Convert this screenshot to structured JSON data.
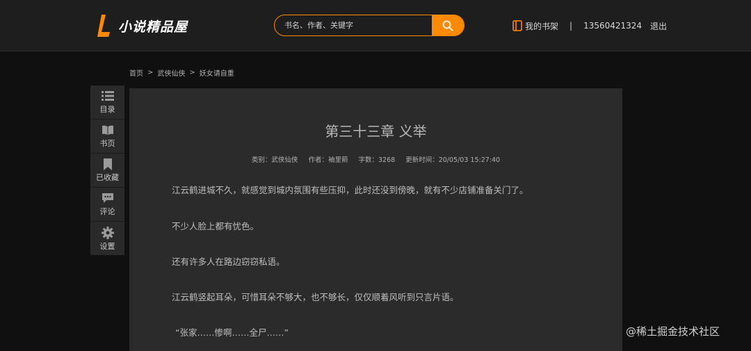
{
  "header": {
    "logo_text": "小说精品屋",
    "search_placeholder": "书名、作者、关键字",
    "shelf_label": "我的书架",
    "separator": "|",
    "phone": "13560421324",
    "logout_label": "退出",
    "accent_color": "#ff8a00"
  },
  "breadcrumb": {
    "items": [
      "首页",
      "武侠仙侠",
      "妖女请自重"
    ],
    "arrow": ">"
  },
  "sidebar": {
    "items": [
      {
        "label": "目录",
        "icon": "list-icon"
      },
      {
        "label": "书页",
        "icon": "book-icon"
      },
      {
        "label": "已收藏",
        "icon": "bookmark-icon"
      },
      {
        "label": "评论",
        "icon": "comment-icon"
      },
      {
        "label": "设置",
        "icon": "gear-icon"
      }
    ]
  },
  "chapter": {
    "title": "第三十三章 义举",
    "meta": {
      "category": "类别：武侠仙侠",
      "author": "作者：袖里箭",
      "word_count": "字数：3268",
      "updated": "更新时间：20/05/03 15:27:40"
    },
    "paragraphs": [
      "江云鹤进城不久，就感觉到城内氛围有些压抑，此时还没到傍晚，就有不少店铺准备关门了。",
      "不少人脸上都有忧色。",
      "还有许多人在路边窃窃私语。",
      "江云鹤竖起耳朵，可惜耳朵不够大，也不够长，仅仅顺着风听到只言片语。",
      "“张家……惨啊……全尸……”"
    ]
  },
  "watermark": "@稀土掘金技术社区"
}
